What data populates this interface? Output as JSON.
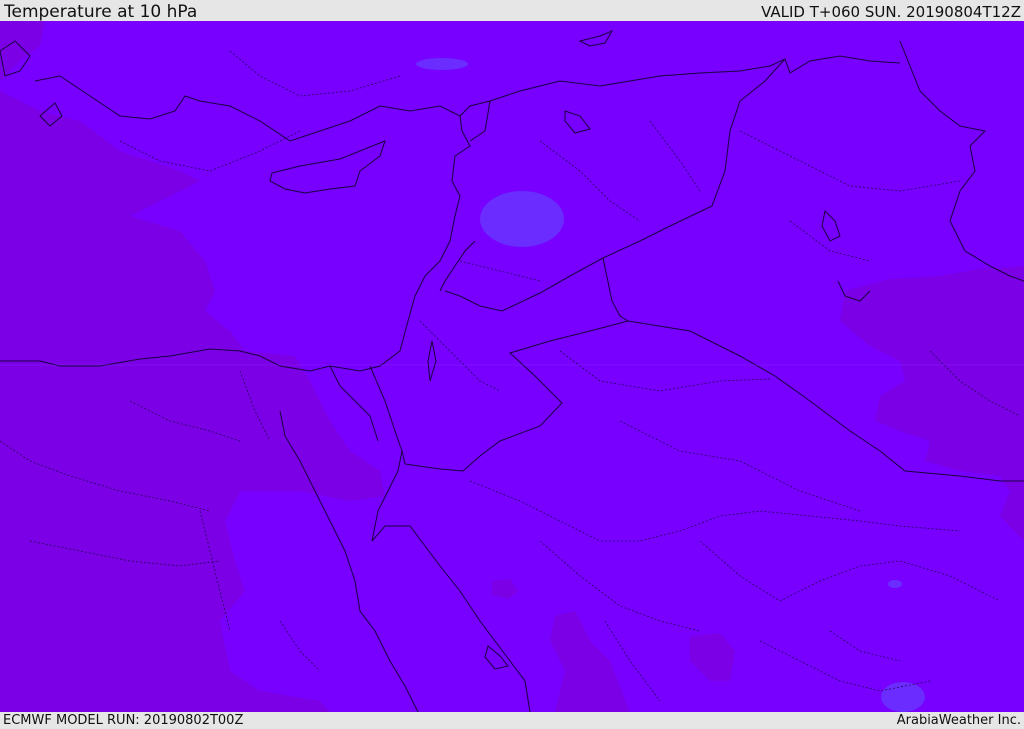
{
  "header": {
    "title": "Temperature at 10 hPa",
    "valid": "VALID T+060 SUN. 20190804T12Z"
  },
  "footer": {
    "model_run": "ECMWF MODEL RUN: 20190802T00Z",
    "credit": "ArabiaWeather Inc."
  },
  "map": {
    "colors": {
      "background": "#7700ff",
      "cool_band": "#7b00e6",
      "warm_spot": "#6a2cff",
      "coast": "#1a0040"
    }
  }
}
